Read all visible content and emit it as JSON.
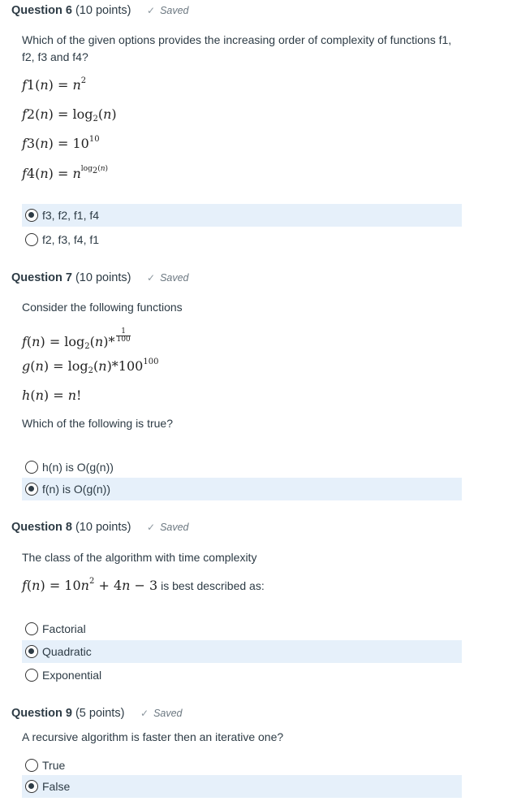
{
  "q6": {
    "title": "Question 6",
    "points": "(10 points)",
    "saved": "Saved",
    "prompt": "Which of the given options provides the increasing order of complexity of functions f1, f2, f3 and f4?",
    "options": [
      {
        "label": "f3, f2, f1, f4",
        "selected": true
      },
      {
        "label": "f2, f3, f4, f1",
        "selected": false
      }
    ]
  },
  "q7": {
    "title": "Question 7",
    "points": "(10 points)",
    "saved": "Saved",
    "prompt": "Consider the following functions",
    "question": "Which of the following is true?",
    "options": [
      {
        "label": "h(n) is O(g(n))",
        "selected": false
      },
      {
        "label": "f(n) is O(g(n))",
        "selected": true
      }
    ]
  },
  "q8": {
    "title": "Question 8",
    "points": "(10 points)",
    "saved": "Saved",
    "prompt": "The class of the algorithm with time complexity",
    "suffix": "is best described as:",
    "options": [
      {
        "label": "Factorial",
        "selected": false
      },
      {
        "label": "Quadratic",
        "selected": true
      },
      {
        "label": "Exponential",
        "selected": false
      }
    ]
  },
  "q9": {
    "title": "Question 9",
    "points": "(5 points)",
    "saved": "Saved",
    "prompt": "A recursive algorithm is faster then an iterative one?",
    "options": [
      {
        "label": "True",
        "selected": false
      },
      {
        "label": "False",
        "selected": true
      }
    ]
  },
  "icons": {
    "saved": "checkmark-icon",
    "radio": "radio-button"
  }
}
